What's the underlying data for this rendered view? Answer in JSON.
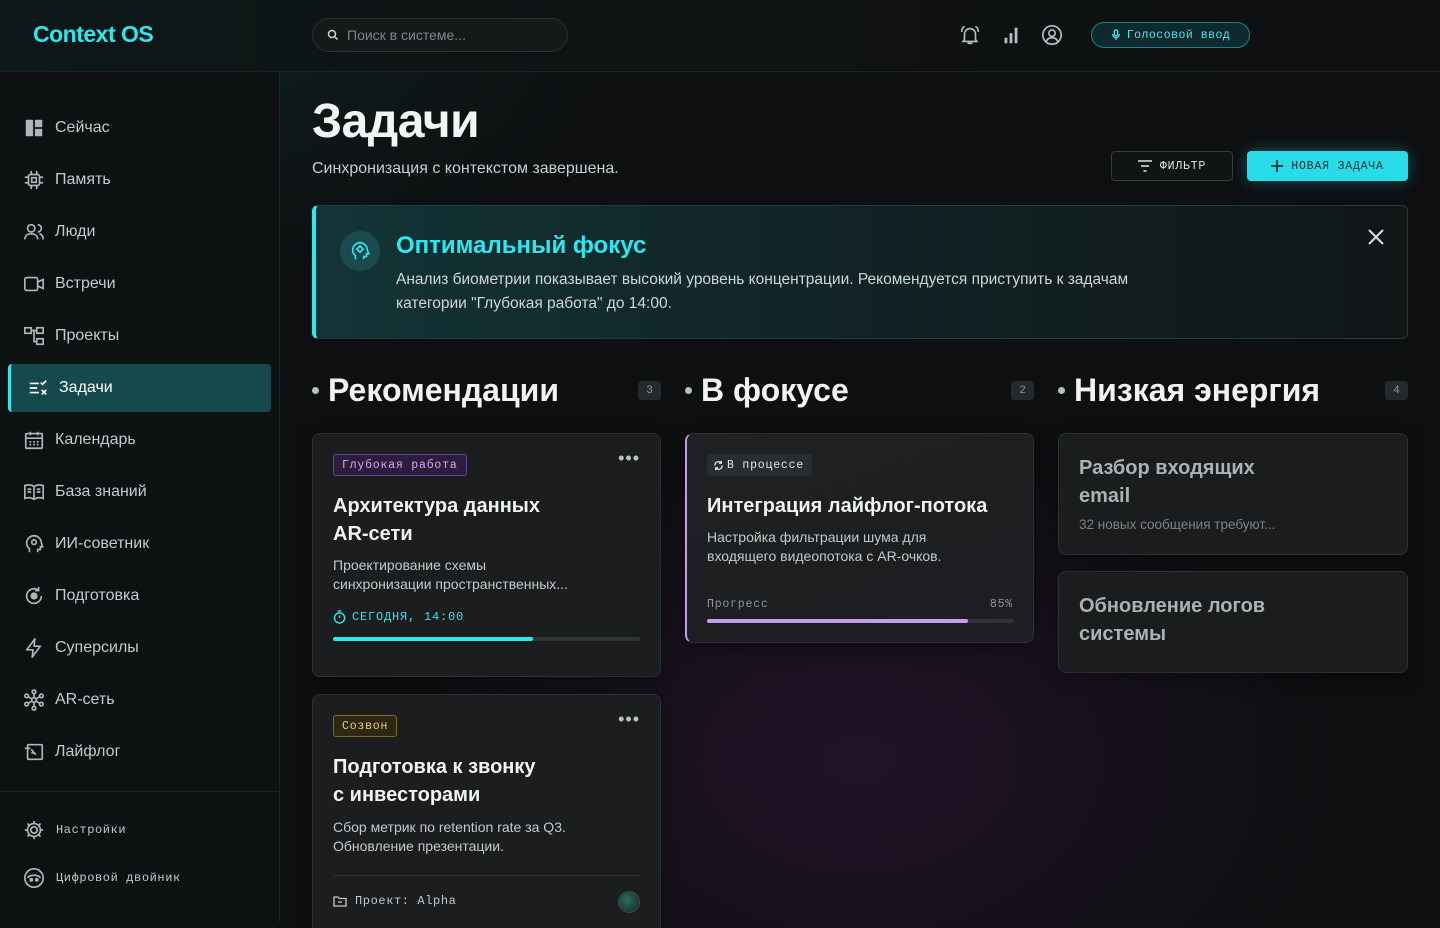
{
  "app": {
    "logo": "Context OS"
  },
  "search": {
    "placeholder": "Поиск в системе..."
  },
  "topbar": {
    "icons": [
      "bell-ring-icon",
      "signal-bars-icon",
      "user-circle-icon"
    ],
    "voice_label": "Голосовой ввод"
  },
  "sidebar": {
    "items": [
      {
        "label": "Сейчас",
        "icon": "dashboard-icon"
      },
      {
        "label": "Память",
        "icon": "chip-icon"
      },
      {
        "label": "Люди",
        "icon": "people-icon"
      },
      {
        "label": "Встречи",
        "icon": "video-icon"
      },
      {
        "label": "Проекты",
        "icon": "hierarchy-icon"
      },
      {
        "label": "Задачи",
        "icon": "checklist-icon",
        "active": true
      },
      {
        "label": "Календарь",
        "icon": "calendar-icon"
      },
      {
        "label": "База знаний",
        "icon": "book-icon"
      },
      {
        "label": "ИИ-советник",
        "icon": "ai-head-icon"
      },
      {
        "label": "Подготовка",
        "icon": "refresh-icon"
      },
      {
        "label": "Суперсилы",
        "icon": "bolt-icon"
      },
      {
        "label": "AR-сеть",
        "icon": "network-icon"
      },
      {
        "label": "Лайфлог",
        "icon": "history-icon"
      }
    ],
    "bottom": [
      {
        "label": "Настройки",
        "icon": "gear-icon"
      },
      {
        "label": "Цифровой двойник",
        "icon": "digital-twin-icon"
      }
    ]
  },
  "header": {
    "title": "Задачи",
    "subtitle": "Синхронизация с контекстом завершена.",
    "filter_label": "ФИЛЬТР",
    "new_task_label": "НОВАЯ ЗАДАЧА"
  },
  "banner": {
    "title": "Оптимальный фокус",
    "text": "Анализ биометрии показывает высокий уровень концентрации. Рекомендуется приступить к задачам категории \"Глубокая работа\" до 14:00."
  },
  "columns": [
    {
      "title": "Рекомендации",
      "count": "3",
      "cards": [
        {
          "tag": "Глубокая работа",
          "title_line1": "Архитектура данных",
          "title_line2": "AR-сети",
          "desc_line1": "Проектирование схемы",
          "desc_line2": "синхронизации пространственных...",
          "due": "СЕГОДНЯ, 14:00",
          "progress": 0.65
        },
        {
          "tag": "Созвон",
          "title_line1": "Подготовка к звонку",
          "title_line2": "с инвесторами",
          "desc_line1": "Сбор метрик по retention rate за Q3.",
          "desc_line2": "Обновление презентации.",
          "project": "Проект: Alpha"
        }
      ]
    },
    {
      "title": "В фокусе",
      "count": "2",
      "cards": [
        {
          "tag": "В процессе",
          "title": "Интеграция лайфлог-потока",
          "desc_line1": "Настройка фильтрации шума для",
          "desc_line2": "входящего видеопотока с AR-очков.",
          "progress_label": "Прогресс",
          "progress_text": "85%",
          "progress": 0.85
        }
      ]
    },
    {
      "title": "Низкая энергия",
      "count": "4",
      "cards": [
        {
          "title_line1": "Разбор входящих",
          "title_line2": "email",
          "desc": "32 новых сообщения требуют..."
        },
        {
          "title_line1": "Обновление логов",
          "title_line2": "системы"
        }
      ]
    }
  ],
  "colors": {
    "accent": "#2ee6ee",
    "purple": "#c59cf2",
    "tag_yellow": "#e9cf7c"
  }
}
